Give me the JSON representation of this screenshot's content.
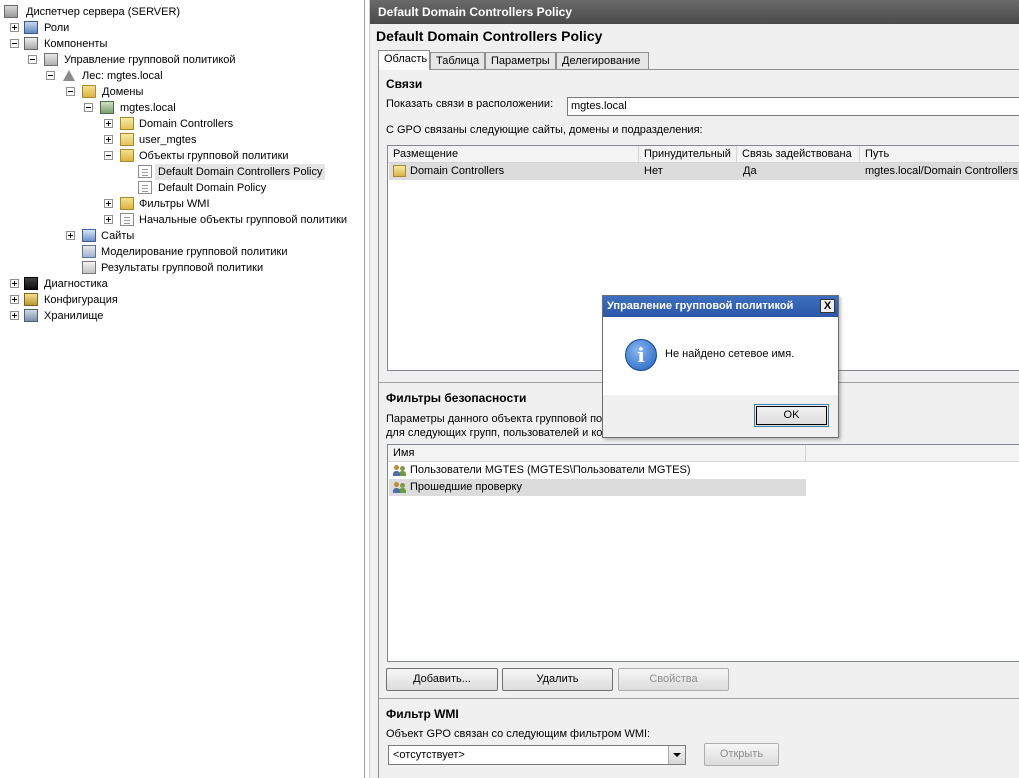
{
  "tree": {
    "items": [
      {
        "label": "Диспетчер сервера (SERVER)",
        "icon": "server-icon"
      },
      {
        "label": "Роли",
        "icon": "roles-icon"
      },
      {
        "label": "Компоненты",
        "icon": "components-icon"
      },
      {
        "label": "Управление групповой политикой",
        "icon": "gpm-icon"
      },
      {
        "label": "Лес: mgtes.local",
        "icon": "forest-icon"
      },
      {
        "label": "Домены",
        "icon": "folder-icon"
      },
      {
        "label": "mgtes.local",
        "icon": "domain-icon"
      },
      {
        "label": "Domain Controllers",
        "icon": "ou-icon"
      },
      {
        "label": "user_mgtes",
        "icon": "ou-icon"
      },
      {
        "label": "Объекты групповой политики",
        "icon": "folder-icon"
      },
      {
        "label": "Default Domain Controllers Policy",
        "icon": "gpo-icon"
      },
      {
        "label": "Default Domain Policy",
        "icon": "gpo-icon"
      },
      {
        "label": "Фильтры WMI",
        "icon": "folder-icon"
      },
      {
        "label": "Начальные объекты групповой политики",
        "icon": "starter-gpo-icon"
      },
      {
        "label": "Сайты",
        "icon": "sites-icon"
      },
      {
        "label": "Моделирование групповой политики",
        "icon": "modeling-icon"
      },
      {
        "label": "Результаты групповой политики",
        "icon": "results-icon"
      },
      {
        "label": "Диагностика",
        "icon": "diagnostics-icon"
      },
      {
        "label": "Конфигурация",
        "icon": "configuration-icon"
      },
      {
        "label": "Хранилище",
        "icon": "storage-icon"
      }
    ]
  },
  "pane": {
    "title": "Default Domain Controllers Policy",
    "heading": "Default Domain Controllers Policy",
    "tabs": [
      {
        "label": "Область"
      },
      {
        "label": "Таблица"
      },
      {
        "label": "Параметры"
      },
      {
        "label": "Делегирование"
      }
    ]
  },
  "links": {
    "heading": "Связи",
    "location_label": "Показать связи в расположении:",
    "location_value": "mgtes.local",
    "description": "С GPO связаны следующие сайты, домены и подразделения:",
    "columns": [
      "Размещение",
      "Принудительный",
      "Связь задействована",
      "Путь"
    ],
    "rows": [
      {
        "location": "Domain Controllers",
        "enforced": "Нет",
        "enabled": "Да",
        "path": "mgtes.local/Domain Controllers"
      }
    ]
  },
  "security": {
    "heading": "Фильтры безопасности",
    "desc_line1": "Параметры данного объекта групповой по",
    "desc_line2": "для следующих групп, пользователей и ко",
    "column_name": "Имя",
    "rows": [
      {
        "name": "Пользователи MGTES (MGTES\\Пользователи MGTES)"
      },
      {
        "name": "Прошедшие проверку"
      }
    ],
    "buttons": {
      "add": "Добавить...",
      "remove": "Удалить",
      "properties": "Свойства"
    }
  },
  "wmi": {
    "heading": "Фильтр WMI",
    "label": "Объект GPO связан со следующим фильтром WMI:",
    "value": "<отсутствует>",
    "open_button": "Открыть"
  },
  "dialog": {
    "title": "Управление групповой политикой",
    "message": "Не найдено сетевое имя.",
    "ok": "OK",
    "close": "X"
  }
}
